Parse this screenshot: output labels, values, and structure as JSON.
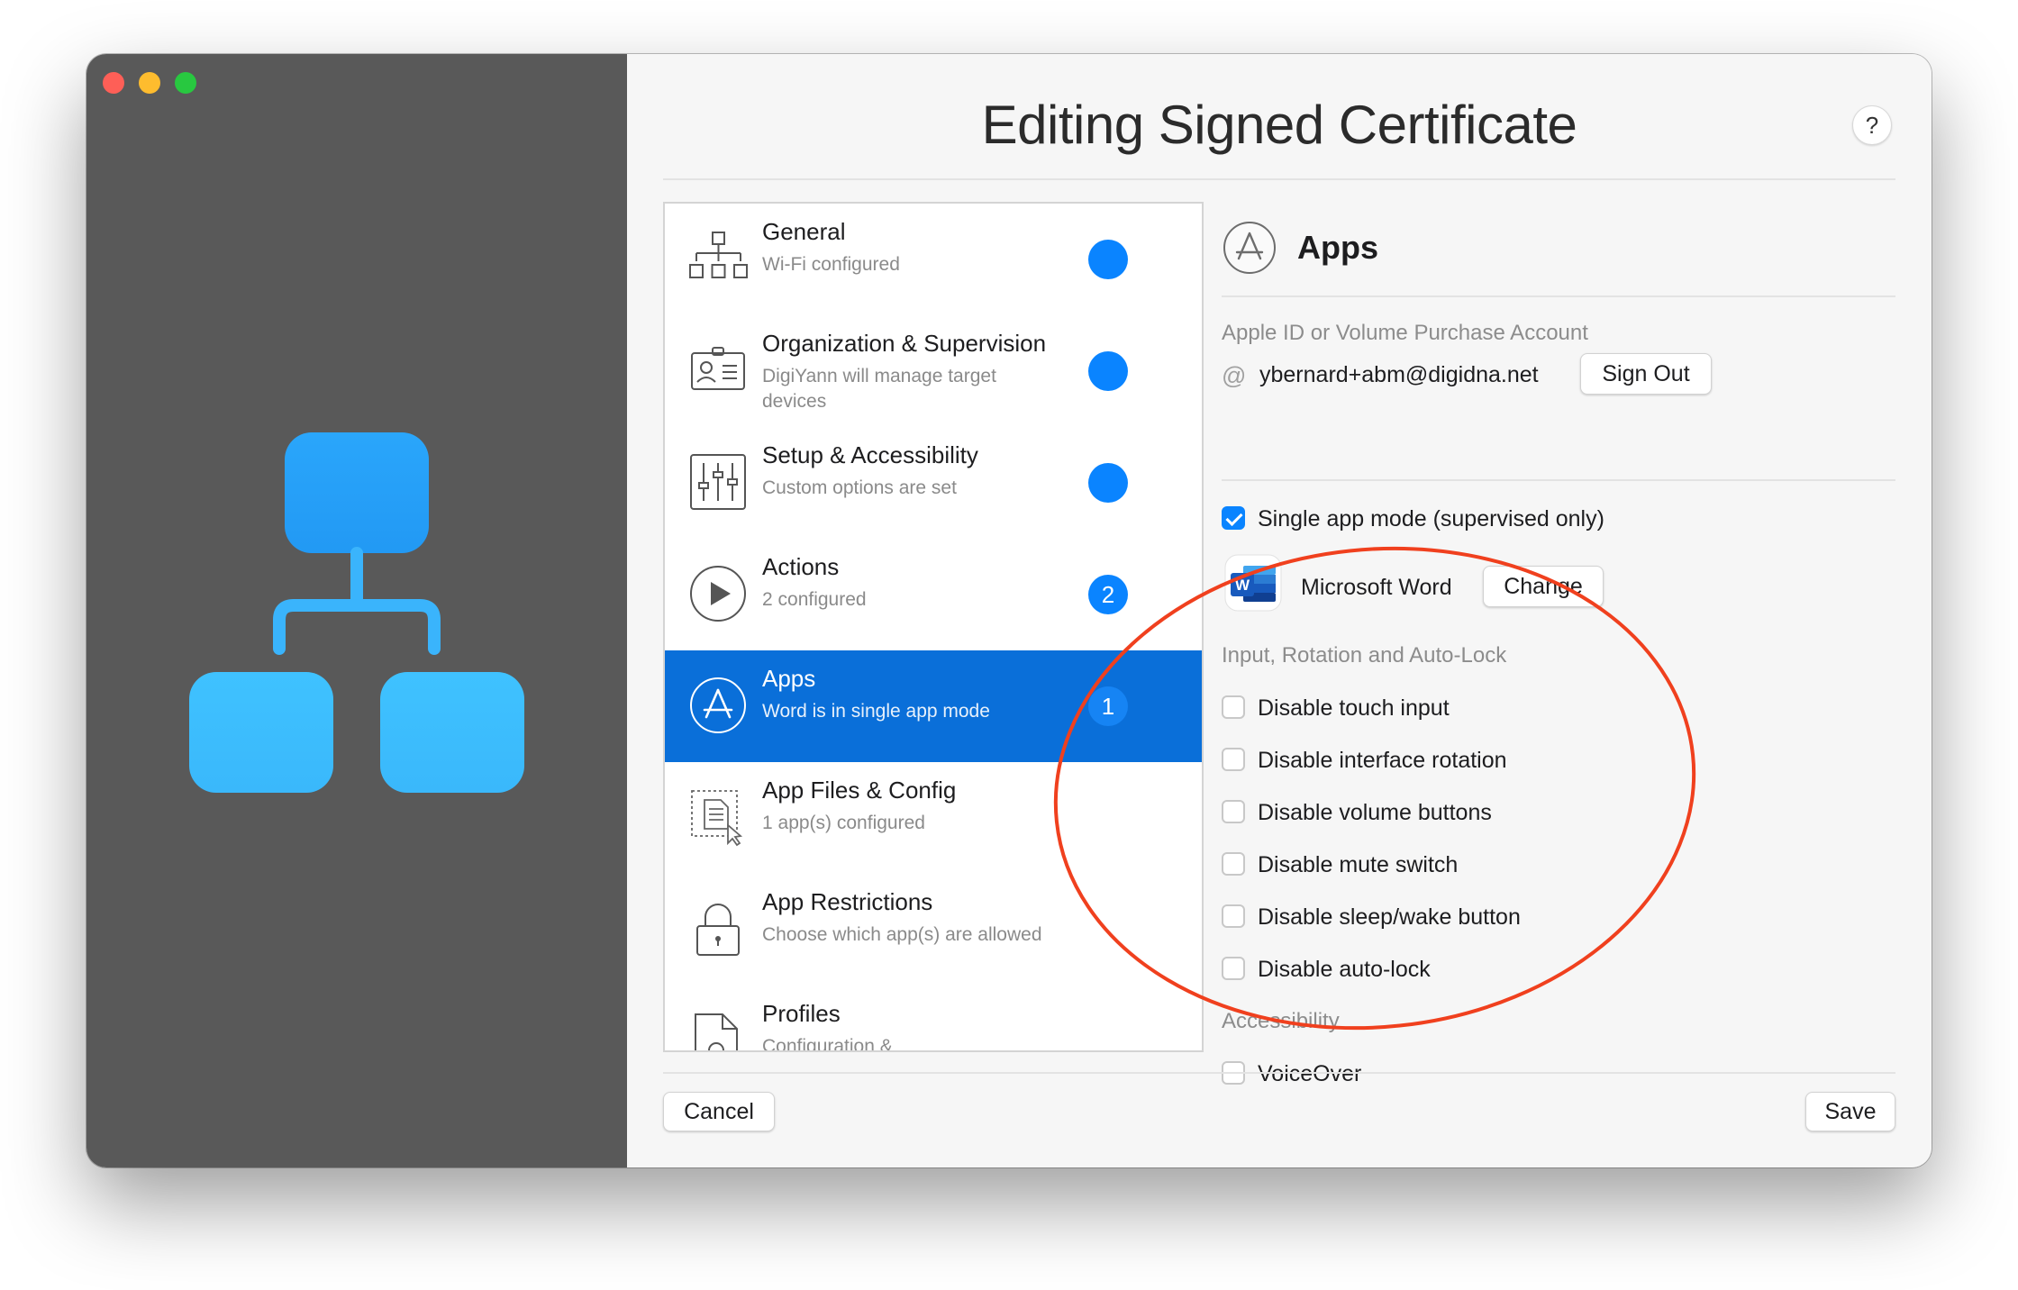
{
  "window": {
    "title": "Editing Signed Certificate",
    "help_label": "?"
  },
  "sidebar": {
    "items": [
      {
        "name": "General",
        "sub": "Wi-Fi configured",
        "badge": ""
      },
      {
        "name": "Organization & Supervision",
        "sub": "DigiYann will manage target devices",
        "badge": ""
      },
      {
        "name": "Setup & Accessibility",
        "sub": "Custom options are set",
        "badge": ""
      },
      {
        "name": "Actions",
        "sub": "2 configured",
        "badge": "2"
      },
      {
        "name": "Apps",
        "sub": "Word is in single app mode",
        "badge": "1"
      },
      {
        "name": "App Files & Config",
        "sub": "1 app(s) configured",
        "badge": ""
      },
      {
        "name": "App Restrictions",
        "sub": "Choose which app(s) are allowed",
        "badge": ""
      },
      {
        "name": "Profiles",
        "sub": "Configuration &",
        "badge": ""
      }
    ]
  },
  "detail": {
    "title": "Apps",
    "account_label": "Apple ID or Volume Purchase Account",
    "account_email": "ybernard+abm@digidna.net",
    "sign_out_label": "Sign Out",
    "single_app_label": "Single app mode (supervised only)",
    "single_app_checked": true,
    "app_name": "Microsoft Word",
    "change_label": "Change",
    "input_section_label": "Input, Rotation and Auto-Lock",
    "options": [
      {
        "label": "Disable touch input",
        "checked": false
      },
      {
        "label": "Disable interface rotation",
        "checked": false
      },
      {
        "label": "Disable volume buttons",
        "checked": false
      },
      {
        "label": "Disable mute switch",
        "checked": false
      },
      {
        "label": "Disable sleep/wake button",
        "checked": false
      },
      {
        "label": "Disable auto-lock",
        "checked": false
      }
    ],
    "accessibility_label": "Accessibility",
    "accessibility_options": [
      {
        "label": "VoiceOver",
        "checked": false
      }
    ]
  },
  "footer": {
    "cancel_label": "Cancel",
    "save_label": "Save"
  },
  "colors": {
    "accent": "#0a84ff",
    "selection": "#0a6fd9",
    "annotation": "#f0401e",
    "left_pane": "#595959",
    "hierarchy_blue": "#2ba8f8"
  }
}
